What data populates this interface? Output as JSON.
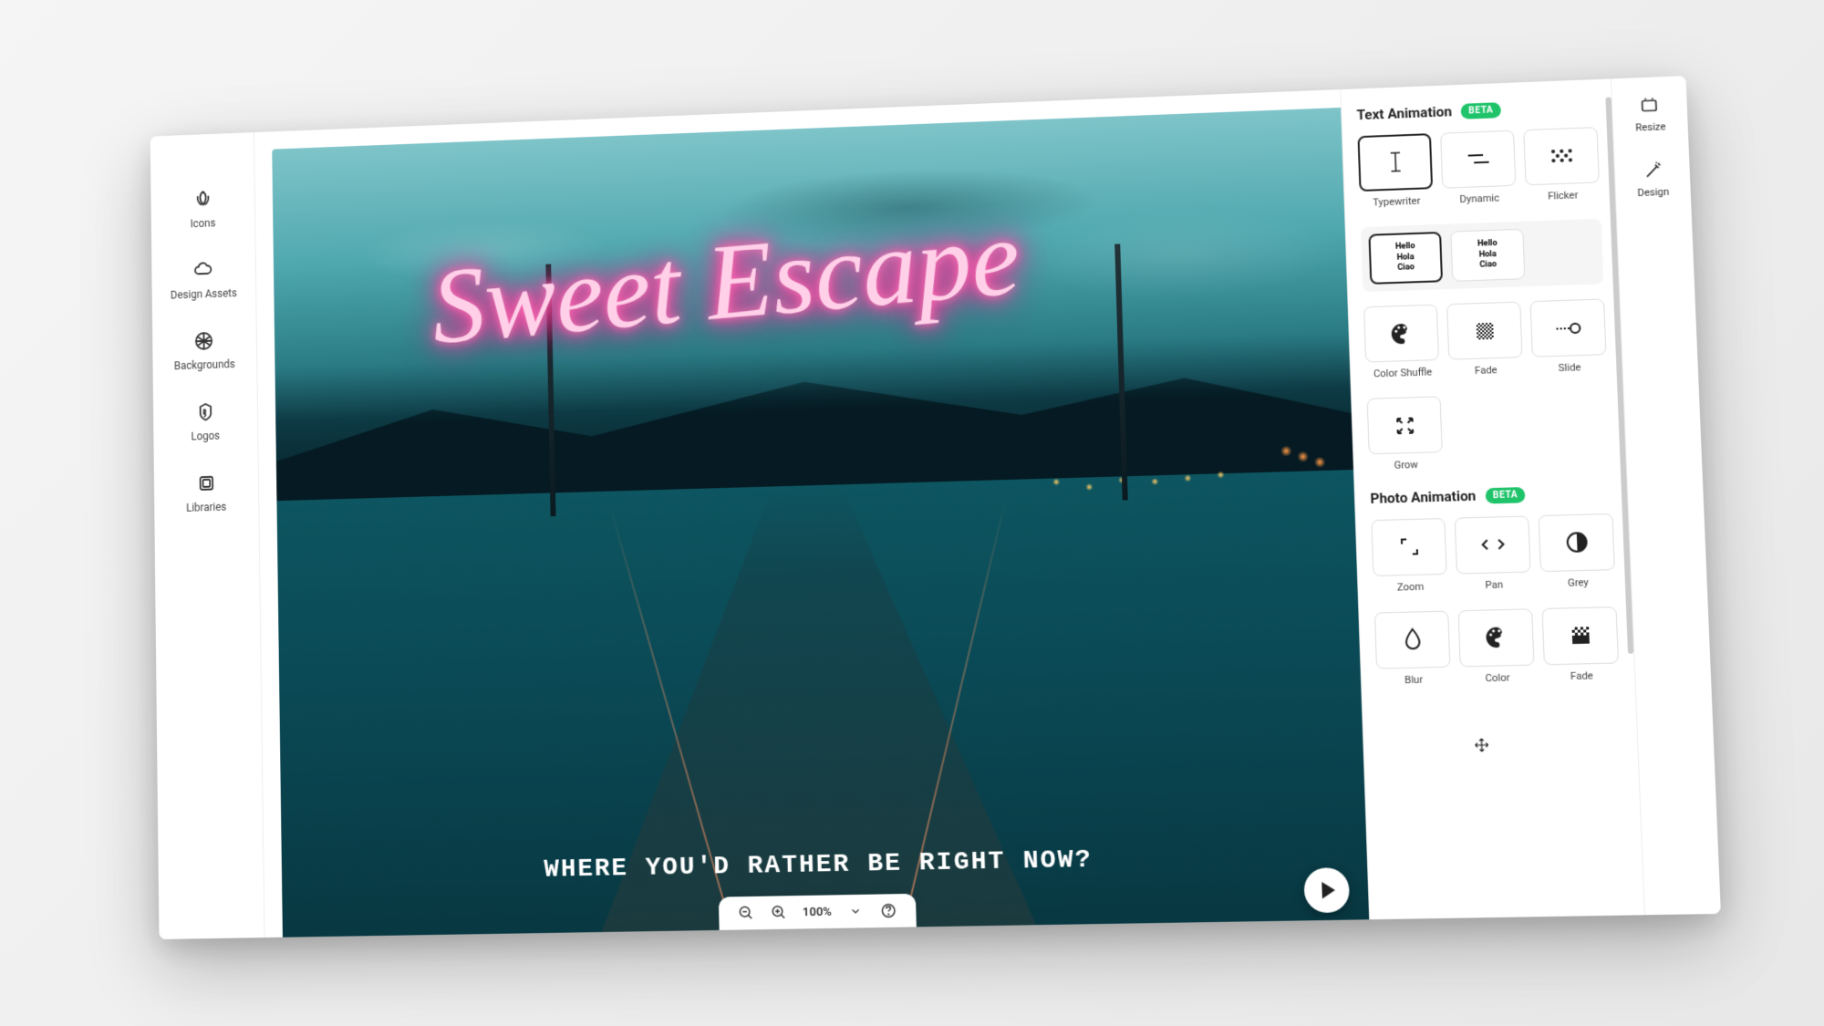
{
  "leftSidebar": {
    "items": [
      {
        "label": "Icons"
      },
      {
        "label": "Design Assets"
      },
      {
        "label": "Backgrounds"
      },
      {
        "label": "Logos"
      },
      {
        "label": "Libraries"
      }
    ]
  },
  "canvas": {
    "neonText": "Sweet Escape",
    "caption": "WHERE YOU'D RATHER BE RIGHT NOW?",
    "zoomLevel": "100%"
  },
  "textAnimation": {
    "title": "Text Animation",
    "badge": "BETA",
    "row1": [
      {
        "label": "Typewriter",
        "selected": true
      },
      {
        "label": "Dynamic"
      },
      {
        "label": "Flicker"
      }
    ],
    "row2": [
      {
        "line1": "Hello",
        "line2": "Hola",
        "line3": "Ciao",
        "selected": true
      },
      {
        "line1": "Hello",
        "line2": "Hola",
        "line3": "Ciao"
      }
    ],
    "row3": [
      {
        "label": "Color Shuffle"
      },
      {
        "label": "Fade"
      },
      {
        "label": "Slide"
      }
    ],
    "row4": [
      {
        "label": "Grow"
      }
    ]
  },
  "photoAnimation": {
    "title": "Photo Animation",
    "badge": "BETA",
    "row1": [
      {
        "label": "Zoom"
      },
      {
        "label": "Pan"
      },
      {
        "label": "Grey"
      }
    ],
    "row2": [
      {
        "label": "Blur"
      },
      {
        "label": "Color"
      },
      {
        "label": "Fade"
      }
    ]
  },
  "farRight": {
    "items": [
      {
        "label": "Resize"
      },
      {
        "label": "Design"
      }
    ]
  }
}
